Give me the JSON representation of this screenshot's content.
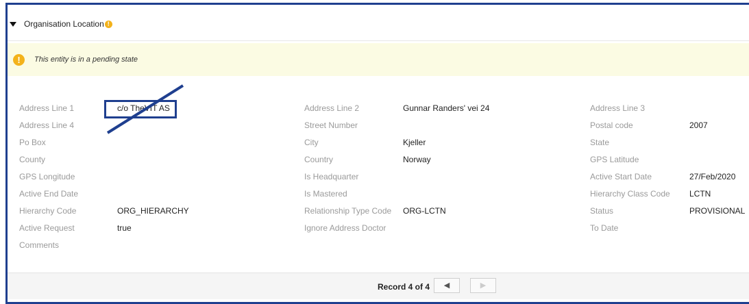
{
  "section": {
    "title": "Organisation Location",
    "info_icon": "warning-icon"
  },
  "pending_banner": {
    "icon": "warning-icon",
    "text": "This entity is in a pending state"
  },
  "fields": [
    [
      {
        "label": "Address Line 1",
        "value": "c/o TheVIT AS"
      },
      {
        "label": "Address Line 2",
        "value": "Gunnar Randers' vei 24"
      },
      {
        "label": "Address Line 3",
        "value": ""
      }
    ],
    [
      {
        "label": "Address Line 4",
        "value": ""
      },
      {
        "label": "Street Number",
        "value": ""
      },
      {
        "label": "Postal code",
        "value": "2007"
      }
    ],
    [
      {
        "label": "Po Box",
        "value": ""
      },
      {
        "label": "City",
        "value": "Kjeller"
      },
      {
        "label": "State",
        "value": ""
      }
    ],
    [
      {
        "label": "County",
        "value": ""
      },
      {
        "label": "Country",
        "value": "Norway"
      },
      {
        "label": "GPS Latitude",
        "value": ""
      }
    ],
    [
      {
        "label": "GPS Longitude",
        "value": ""
      },
      {
        "label": "Is Headquarter",
        "value": ""
      },
      {
        "label": "Active Start Date",
        "value": "27/Feb/2020"
      }
    ],
    [
      {
        "label": "Active End Date",
        "value": ""
      },
      {
        "label": "Is Mastered",
        "value": ""
      },
      {
        "label": "Hierarchy Class Code",
        "value": "LCTN"
      }
    ],
    [
      {
        "label": "Hierarchy Code",
        "value": "ORG_HIERARCHY"
      },
      {
        "label": "Relationship Type Code",
        "value": "ORG-LCTN"
      },
      {
        "label": "Status",
        "value": "PROVISIONAL"
      }
    ],
    [
      {
        "label": "Active Request",
        "value": "true"
      },
      {
        "label": "Ignore Address Doctor",
        "value": ""
      },
      {
        "label": "To Date",
        "value": ""
      }
    ],
    [
      {
        "label": "Comments",
        "value": ""
      },
      {
        "label": "",
        "value": ""
      },
      {
        "label": "",
        "value": ""
      }
    ]
  ],
  "pager": {
    "record_text": "Record 4 of 4",
    "prev_icon": "chevron-left-icon",
    "next_icon": "chevron-right-icon",
    "prev_glyph": "◀",
    "next_glyph": "▶"
  },
  "colors": {
    "annotation": "#1f3f8f",
    "warning": "#f3b21b",
    "banner_bg": "#fbfbe3"
  }
}
